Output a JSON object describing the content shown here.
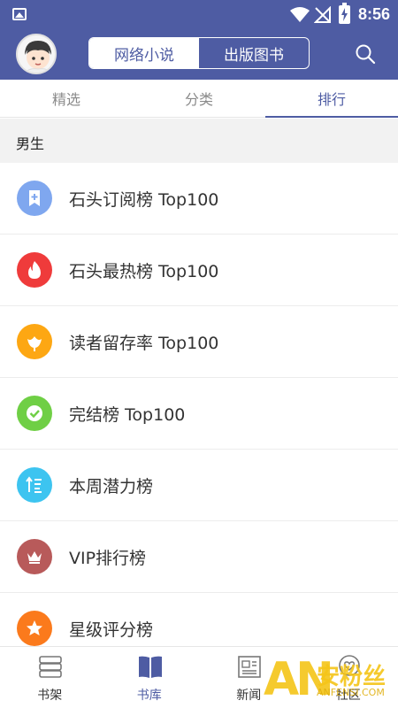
{
  "status_bar": {
    "time": "8:56"
  },
  "header": {
    "segments": [
      {
        "label": "网络小说",
        "active": true
      },
      {
        "label": "出版图书",
        "active": false
      }
    ]
  },
  "tabs": [
    {
      "label": "精选",
      "active": false
    },
    {
      "label": "分类",
      "active": false
    },
    {
      "label": "排行",
      "active": true
    }
  ],
  "section": {
    "title": "男生"
  },
  "rankings": [
    {
      "label": "石头订阅榜 Top100",
      "color": "#7fa7ef",
      "icon": "bookmark-plus-icon"
    },
    {
      "label": "石头最热榜 Top100",
      "color": "#ef3b3b",
      "icon": "flame-icon"
    },
    {
      "label": "读者留存率 Top100",
      "color": "#fda713",
      "icon": "lotus-icon"
    },
    {
      "label": "完结榜 Top100",
      "color": "#6fcf45",
      "icon": "check-circle-icon"
    },
    {
      "label": "本周潜力榜",
      "color": "#3dc4f0",
      "icon": "sort-up-icon"
    },
    {
      "label": "VIP排行榜",
      "color": "#b85a5a",
      "icon": "crown-icon"
    },
    {
      "label": "星级评分榜",
      "color": "#fb7a1c",
      "icon": "star-icon"
    }
  ],
  "bottom_nav": [
    {
      "label": "书架",
      "active": false,
      "icon": "bookshelf-icon"
    },
    {
      "label": "书库",
      "active": true,
      "icon": "open-book-icon"
    },
    {
      "label": "新闻",
      "active": false,
      "icon": "newspaper-icon"
    },
    {
      "label": "社区",
      "active": false,
      "icon": "community-icon"
    }
  ],
  "watermark": {
    "logo": "AN",
    "text": "安粉丝",
    "url": "ANFENSI.COM"
  }
}
